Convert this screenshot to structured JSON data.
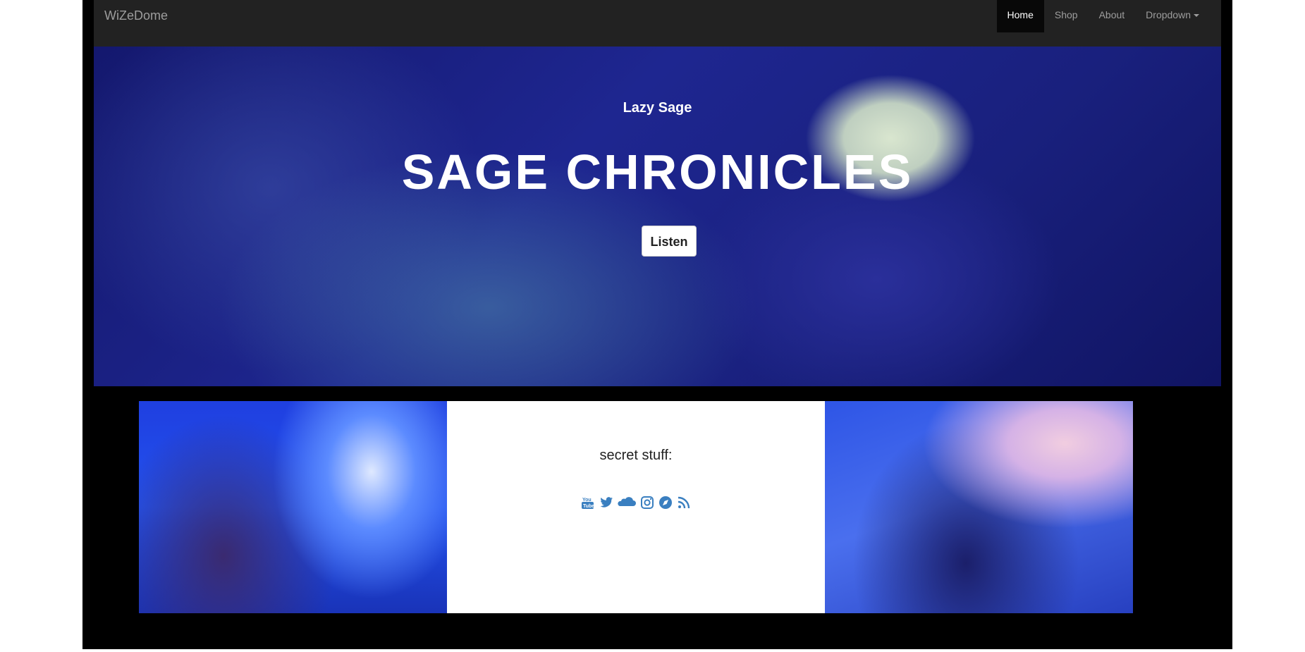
{
  "navbar": {
    "brand": "WiZeDome",
    "items": [
      {
        "label": "Home",
        "active": true
      },
      {
        "label": "Shop"
      },
      {
        "label": "About"
      },
      {
        "label": "Dropdown"
      }
    ]
  },
  "hero": {
    "subtitle": "Lazy Sage",
    "title": "SAGE CHRONICLES",
    "button_label": "Listen"
  },
  "center_panel": {
    "heading": "secret stuff:",
    "social_icons": [
      "youtube-icon",
      "twitter-icon",
      "soundcloud-icon",
      "instagram-icon",
      "compass-icon",
      "rss-icon"
    ],
    "icon_color": "#3a7fc0"
  },
  "colors": {
    "navbar_bg": "#222222",
    "page_bg": "#000000",
    "nav_text": "#9d9d9d",
    "nav_active_bg": "#080808"
  }
}
